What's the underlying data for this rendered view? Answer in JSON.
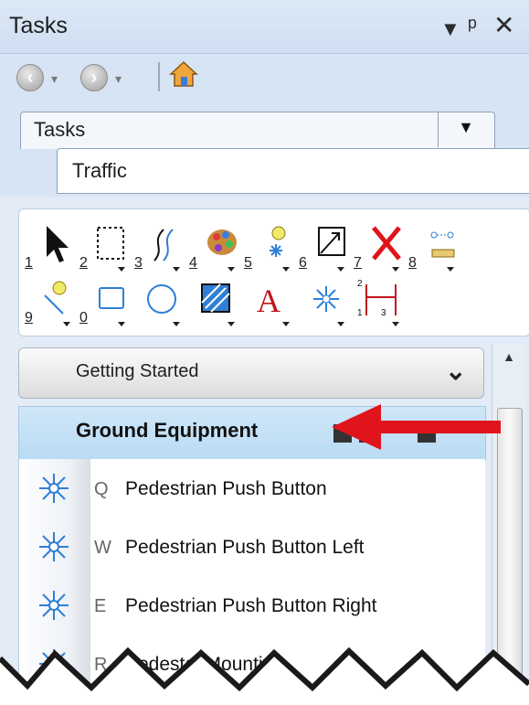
{
  "window": {
    "title": "Tasks",
    "controls": [
      "▾",
      "ᵖ",
      "✕"
    ]
  },
  "nav": {
    "back_icon": "back-arrow-icon",
    "forward_icon": "forward-arrow-icon",
    "home_icon": "home-icon"
  },
  "tabs": {
    "current": "Tasks",
    "sub": "Traffic"
  },
  "tools": [
    {
      "num": "1",
      "icon": "select-arrow-icon"
    },
    {
      "num": "2",
      "icon": "fence-selection-icon"
    },
    {
      "num": "3",
      "icon": "curve-icon"
    },
    {
      "num": "4",
      "icon": "palette-icon"
    },
    {
      "num": "5",
      "icon": "light-bulb-icon"
    },
    {
      "num": "6",
      "icon": "scale-icon"
    },
    {
      "num": "7",
      "icon": "delete-x-icon"
    },
    {
      "num": "8",
      "icon": "measure-icon"
    },
    {
      "num": "9",
      "icon": "place-bulb-icon"
    },
    {
      "num": "0",
      "icon": "rectangle-icon"
    },
    {
      "num": "",
      "icon": "circle-icon"
    },
    {
      "num": "",
      "icon": "hatch-icon"
    },
    {
      "num": "",
      "icon": "text-icon"
    },
    {
      "num": "",
      "icon": "signal-icon"
    },
    {
      "num": "",
      "icon": "dimension-icon"
    }
  ],
  "sections": {
    "getting_started": "Getting Started",
    "ground_equipment": "Ground Equipment"
  },
  "items": [
    {
      "key": "Q",
      "label": "Pedestrian Push Button"
    },
    {
      "key": "W",
      "label": "Pedestrian Push Button Left"
    },
    {
      "key": "E",
      "label": "Pedestrian Push Button Right"
    },
    {
      "key": "R",
      "label": "Pedestal Mounting"
    }
  ],
  "colors": {
    "accent_arrow": "#e0141c",
    "icon_blue": "#2f7fd6",
    "header_blue": "#c4e0f6"
  }
}
